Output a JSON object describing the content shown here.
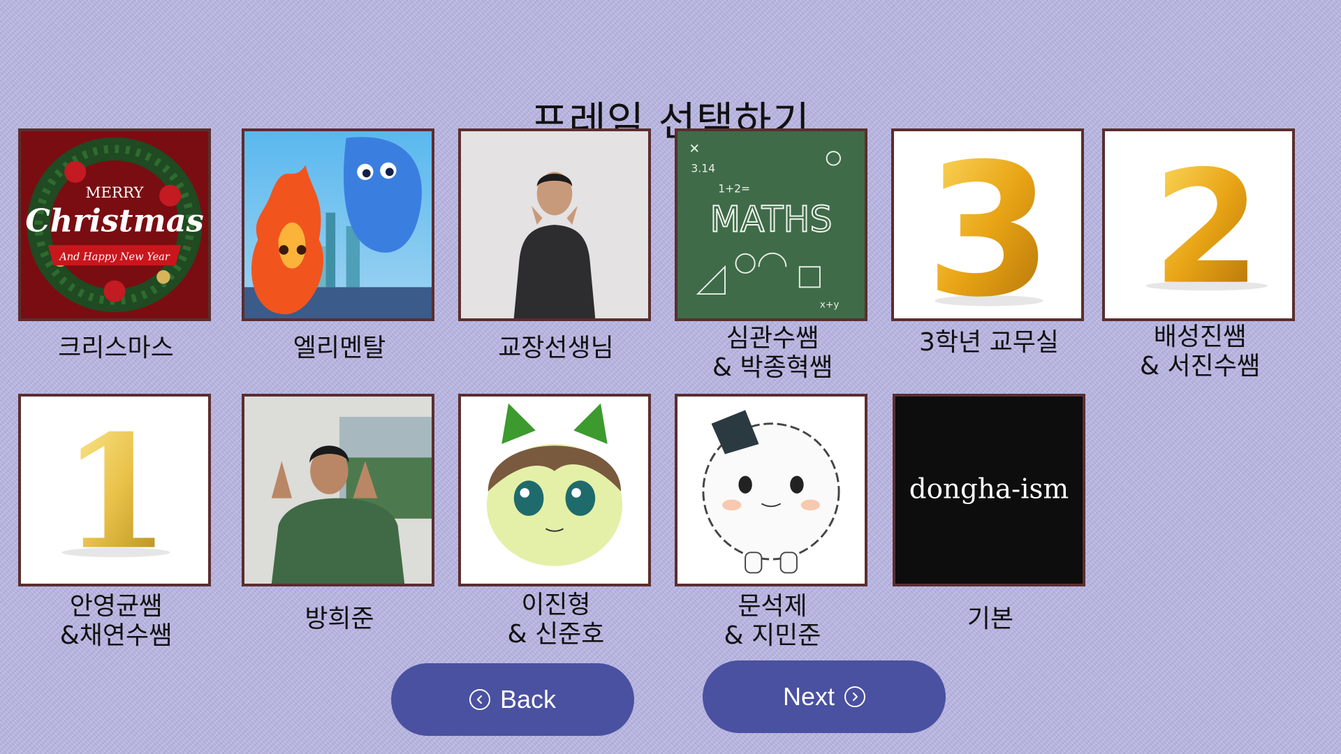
{
  "title": "프레임 선택하기",
  "frames": [
    {
      "label": "크리스마스",
      "art": {
        "line1": "MERRY",
        "line2": "Christmas",
        "line3": "And Happy New Year"
      }
    },
    {
      "label": "엘리멘탈"
    },
    {
      "label": "교장선생님"
    },
    {
      "label": "심관수쌤\n& 박종혁쌤",
      "art": {
        "word": "MATHS",
        "formula1": "3.14",
        "formula2": "1+2=",
        "formula3": "x+y"
      }
    },
    {
      "label": "3학년 교무실",
      "art": {
        "digit": "3"
      }
    },
    {
      "label": "배성진쌤\n& 서진수쌤",
      "art": {
        "digit": "2"
      }
    },
    {
      "label": "안영균쌤\n&채연수쌤",
      "art": {
        "digit": "1"
      }
    },
    {
      "label": "방희준"
    },
    {
      "label": "이진형\n& 신준호"
    },
    {
      "label": "문석제\n& 지민준"
    },
    {
      "label": "기본",
      "art": {
        "text": "dongha-ism"
      }
    }
  ],
  "buttons": {
    "back": {
      "label": "Back",
      "icon": "chevron-left-circle-icon"
    },
    "next": {
      "label": "Next",
      "icon": "chevron-right-circle-icon"
    }
  },
  "colors": {
    "background": "#b9b6e4",
    "button": "#4a51a0",
    "tile_border": "#5a2e2e"
  }
}
